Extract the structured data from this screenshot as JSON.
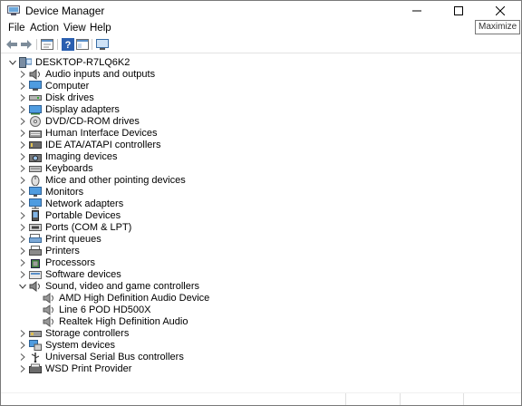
{
  "window": {
    "title": "Device Manager"
  },
  "tooltip": "Maximize",
  "menu": [
    {
      "label": "File"
    },
    {
      "label": "Action"
    },
    {
      "label": "View"
    },
    {
      "label": "Help"
    }
  ],
  "toolbar": [
    "back-icon",
    "forward-icon",
    "properties-icon",
    "help-icon",
    "show-hide-icon",
    "scan-icon"
  ],
  "tree": {
    "root": "DESKTOP-R7LQ6K2",
    "categories": [
      {
        "label": "Audio inputs and outputs",
        "icon": "speaker-icon"
      },
      {
        "label": "Computer",
        "icon": "computer-icon"
      },
      {
        "label": "Disk drives",
        "icon": "disk-icon"
      },
      {
        "label": "Display adapters",
        "icon": "display-adapter-icon"
      },
      {
        "label": "DVD/CD-ROM drives",
        "icon": "dvd-icon"
      },
      {
        "label": "Human Interface Devices",
        "icon": "hid-icon"
      },
      {
        "label": "IDE ATA/ATAPI controllers",
        "icon": "ide-icon"
      },
      {
        "label": "Imaging devices",
        "icon": "camera-icon"
      },
      {
        "label": "Keyboards",
        "icon": "keyboard-icon"
      },
      {
        "label": "Mice and other pointing devices",
        "icon": "mouse-icon"
      },
      {
        "label": "Monitors",
        "icon": "monitor-icon"
      },
      {
        "label": "Network adapters",
        "icon": "network-icon"
      },
      {
        "label": "Portable Devices",
        "icon": "portable-icon"
      },
      {
        "label": "Ports (COM & LPT)",
        "icon": "port-icon"
      },
      {
        "label": "Print queues",
        "icon": "print-queue-icon"
      },
      {
        "label": "Printers",
        "icon": "printer-icon"
      },
      {
        "label": "Processors",
        "icon": "processor-icon"
      },
      {
        "label": "Software devices",
        "icon": "software-icon"
      },
      {
        "label": "Sound, video and game controllers",
        "icon": "sound-icon",
        "expanded": true,
        "children": [
          "AMD High Definition Audio Device",
          "Line 6 POD HD500X",
          "Realtek High Definition Audio"
        ]
      },
      {
        "label": "Storage controllers",
        "icon": "storage-icon"
      },
      {
        "label": "System devices",
        "icon": "system-icon"
      },
      {
        "label": "Universal Serial Bus controllers",
        "icon": "usb-icon"
      },
      {
        "label": "WSD Print Provider",
        "icon": "wsd-icon"
      }
    ]
  },
  "colors": {
    "accent": "#1e78c8",
    "title_bg": "#ffffff",
    "border": "#7a7a7a"
  }
}
